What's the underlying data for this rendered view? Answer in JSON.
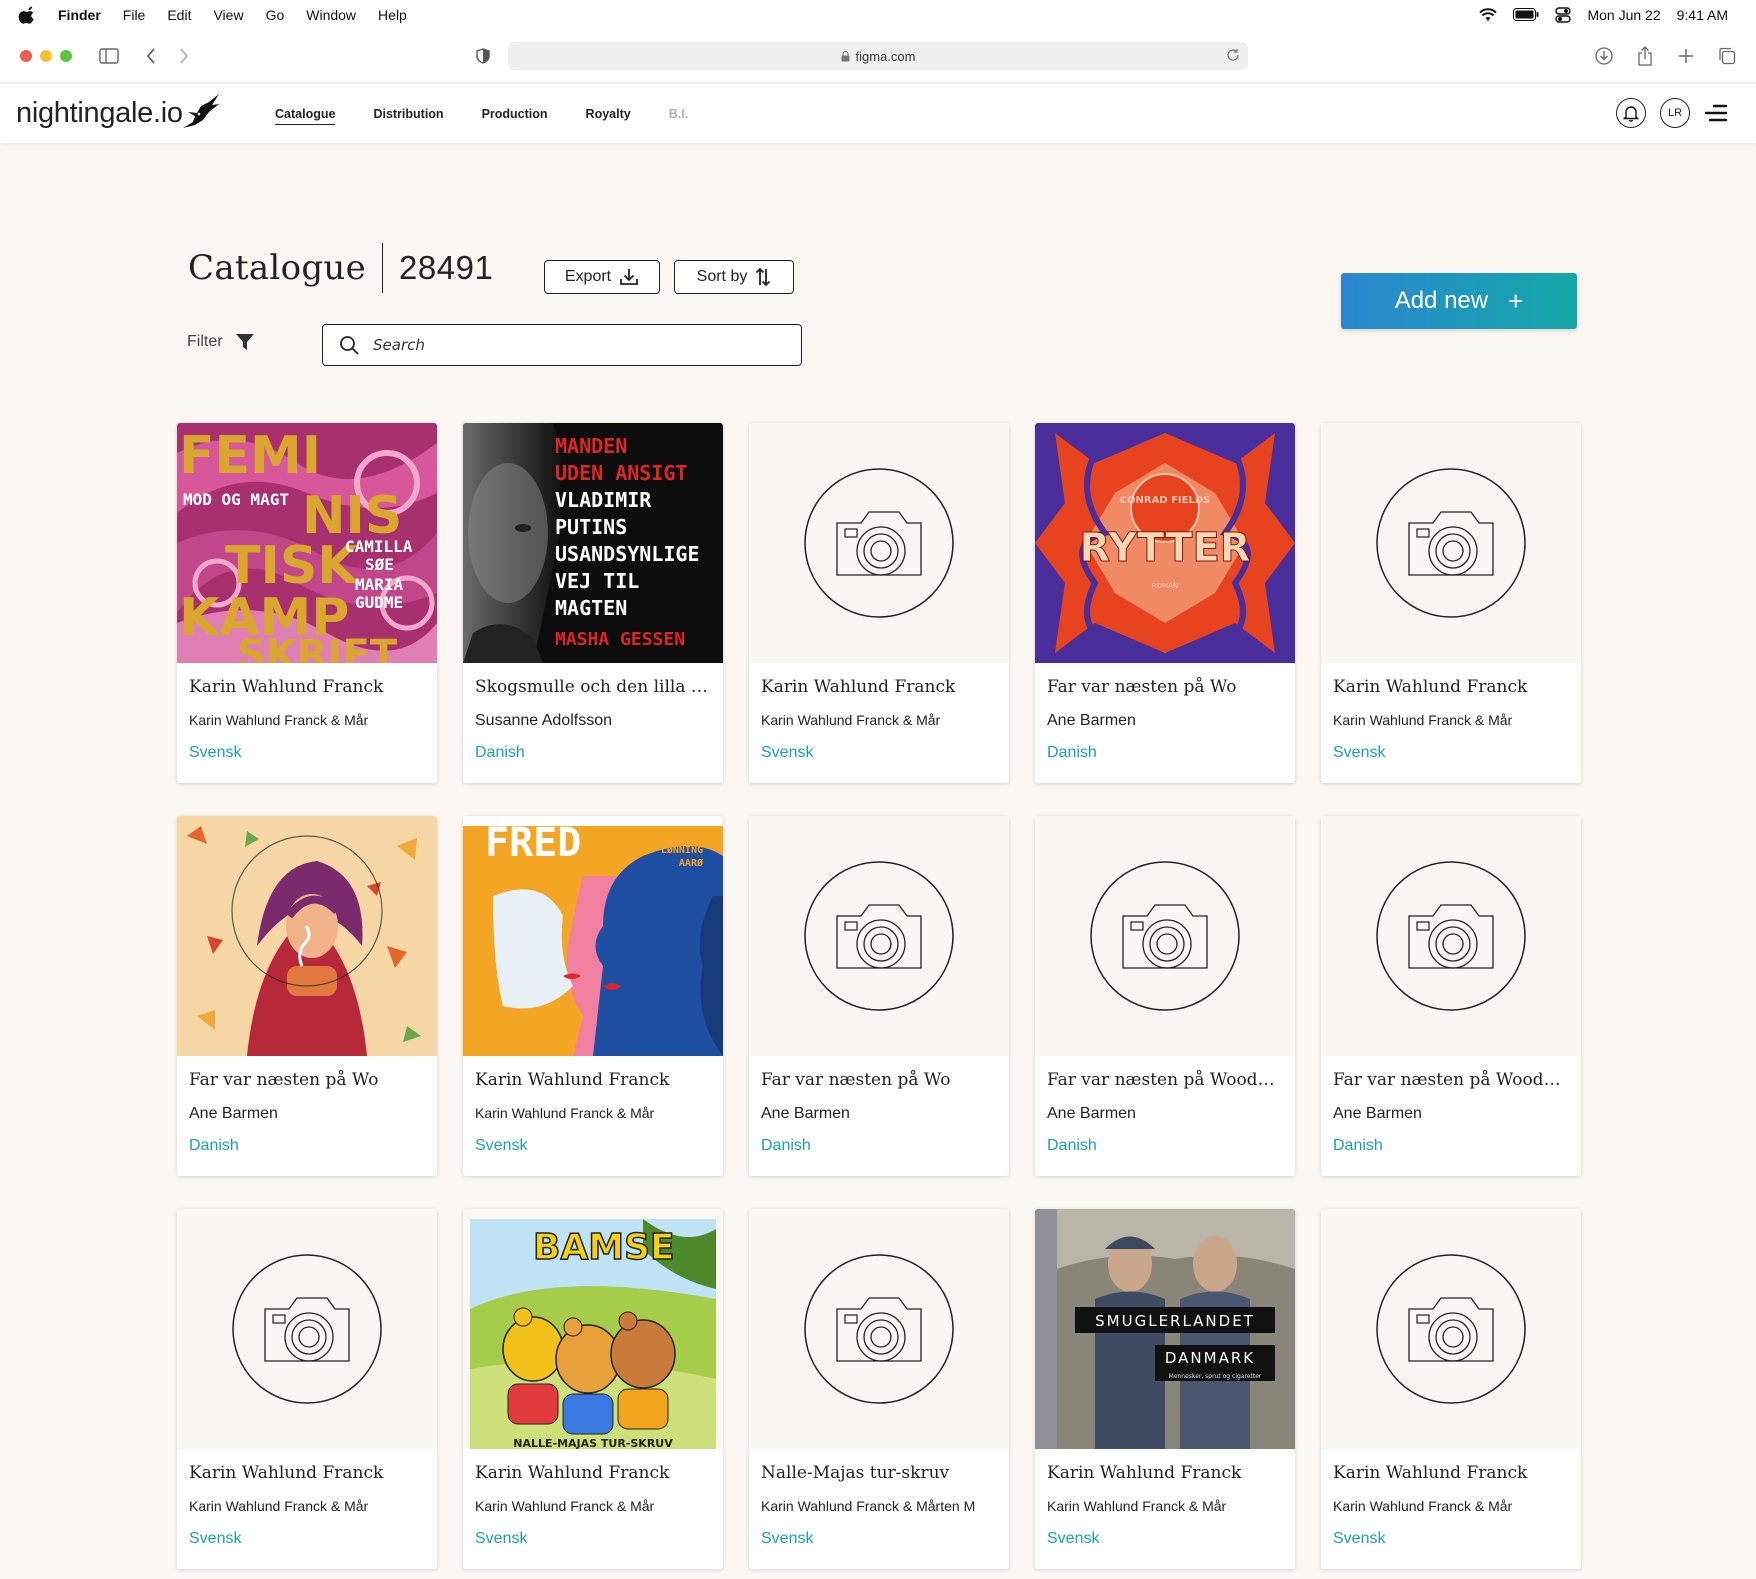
{
  "menubar": {
    "items": [
      "Finder",
      "File",
      "Edit",
      "View",
      "Go",
      "Window",
      "Help"
    ],
    "date": "Mon Jun 22",
    "time": "9:41 AM"
  },
  "browser": {
    "url": "figma.com"
  },
  "app": {
    "logo": "nightingale.io",
    "nav": [
      "Catalogue",
      "Distribution",
      "Production",
      "Royalty",
      "B.I."
    ],
    "active_nav": "Catalogue",
    "user_initials": "LR"
  },
  "catalogue": {
    "title": "Catalogue",
    "count": "28491",
    "export_label": "Export",
    "sort_label": "Sort by",
    "add_new_label": "Add new",
    "filter_label": "Filter",
    "search_placeholder": "Search"
  },
  "colors": {
    "accent_start": "#2a86d1",
    "accent_end": "#14a9a8",
    "language": "#1aa0b4"
  },
  "cards": [
    {
      "title": "Karin Wahlund Franck",
      "author": "Karin Wahlund Franck & Mår",
      "language": "Svensk",
      "cover": "feministisk"
    },
    {
      "title": "Skogsmulle och den lilla ren...",
      "author": "Susanne Adolfsson",
      "language": "Danish",
      "cover": "manden"
    },
    {
      "title": "Karin Wahlund Franck",
      "author": "Karin Wahlund Franck & Mår",
      "language": "Svensk",
      "cover": "placeholder"
    },
    {
      "title": "Far var næsten på Wo",
      "author": "Ane Barmen",
      "language": "Danish",
      "cover": "rytter"
    },
    {
      "title": "Karin Wahlund Franck",
      "author": "Karin Wahlund Franck & Mår",
      "language": "Svensk",
      "cover": "placeholder"
    },
    {
      "title": "Far var næsten på Wo",
      "author": "Ane Barmen",
      "language": "Danish",
      "cover": "autumn"
    },
    {
      "title": "Karin Wahlund Franck",
      "author": "Karin Wahlund Franck & Mår",
      "language": "Svensk",
      "cover": "fred"
    },
    {
      "title": "Far var næsten på Wo",
      "author": "Ane Barmen",
      "language": "Danish",
      "cover": "placeholder"
    },
    {
      "title": "Far var næsten på Woodstock",
      "author": "Ane Barmen",
      "language": "Danish",
      "cover": "placeholder"
    },
    {
      "title": "Far var næsten på Woodstock",
      "author": "Ane Barmen",
      "language": "Danish",
      "cover": "placeholder"
    },
    {
      "title": "Karin Wahlund Franck",
      "author": "Karin Wahlund Franck & Mår",
      "language": "Svensk",
      "cover": "placeholder"
    },
    {
      "title": "Karin Wahlund Franck",
      "author": "Karin Wahlund Franck & Mår",
      "language": "Svensk",
      "cover": "bamse"
    },
    {
      "title": "Nalle-Majas tur-skruv",
      "author": "Karin Wahlund Franck & Mårten M",
      "language": "Svensk",
      "cover": "placeholder"
    },
    {
      "title": "Karin Wahlund Franck",
      "author": "Karin Wahlund Franck & Mår",
      "language": "Svensk",
      "cover": "smuglerlandet"
    },
    {
      "title": "Karin Wahlund Franck",
      "author": "Karin Wahlund Franck & Mår",
      "language": "Svensk",
      "cover": "placeholder"
    }
  ],
  "cover_text": {
    "feministisk": {
      "line1": "FEMI",
      "line2": "NIS",
      "line3": "TISK",
      "line4": "KAMP",
      "line5": "SKRIFT",
      "subtitle": "MOD OG MAGT",
      "author1": "CAMILLA",
      "author2": "SØE",
      "author3": "MARIA",
      "author4": "GUDME"
    },
    "manden": {
      "lines_red": [
        "MANDEN",
        "UDEN ANSIGT"
      ],
      "lines_white": [
        "VLADIMIR",
        "PUTINS",
        "USANDSYNLIGE",
        "VEJ TIL",
        "MAGTEN"
      ],
      "author": "MASHA GESSEN"
    },
    "rytter": {
      "author": "CONRAD FIELDS",
      "title": "RYTTER",
      "sub": "ROMAN"
    },
    "fred": {
      "title": "FRED",
      "author1": "SELMA",
      "author2": "LØNNING",
      "author3": "AARØ"
    },
    "bamse": {
      "title": "BAMSE",
      "subtitle": "NALLE-MAJAS TUR-SKRUV"
    },
    "smuglerlandet": {
      "line1": "SMUGLERLANDET",
      "line2": "DANMARK",
      "sub": "Mennesker, sprut og cigaretter"
    }
  }
}
